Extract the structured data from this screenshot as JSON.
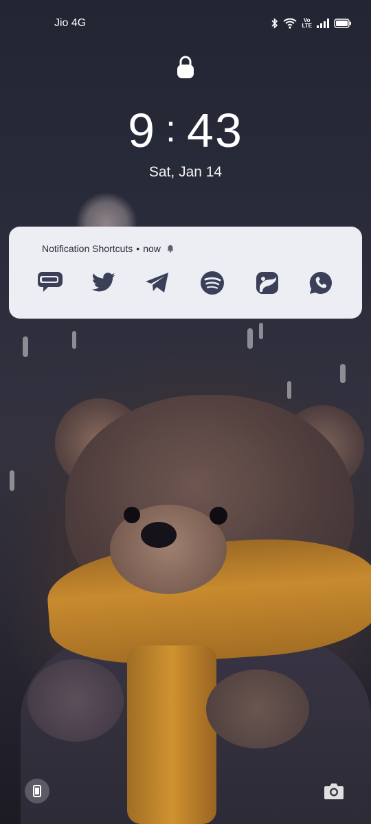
{
  "status_bar": {
    "carrier": "Jio 4G",
    "icons": [
      "bluetooth-icon",
      "wifi-icon",
      "volte-icon",
      "signal-icon",
      "battery-icon"
    ],
    "volte_top": "Vo",
    "volte_bottom": "LTE"
  },
  "lockscreen": {
    "hours": "9",
    "separator": ":",
    "minutes": "43",
    "date": "Sat, Jan 14"
  },
  "notification": {
    "app_name": "Notification Shortcuts",
    "separator": "•",
    "time": "now",
    "shortcuts": [
      "messages-icon",
      "twitter-icon",
      "telegram-icon",
      "spotify-icon",
      "gallery-icon",
      "whatsapp-icon"
    ]
  },
  "bottom_actions": [
    "device-icon",
    "camera-icon"
  ],
  "colors": {
    "card_background": "#eceef3",
    "shortcut_icon": "#3b3f58",
    "text_dark": "#2a2b34"
  }
}
